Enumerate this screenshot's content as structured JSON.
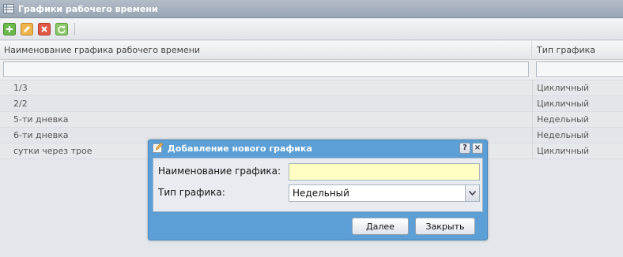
{
  "panel": {
    "title": "Графики рабочего времени"
  },
  "toolbar": {
    "buttons": [
      {
        "name": "add",
        "icon": "plus-icon",
        "color": "#5aa83a"
      },
      {
        "name": "edit",
        "icon": "pencil-icon",
        "color": "#e4a23a"
      },
      {
        "name": "delete",
        "icon": "x-icon",
        "color": "#d64a3a"
      },
      {
        "name": "refresh",
        "icon": "refresh-icon",
        "color": "#5aa83a"
      }
    ]
  },
  "grid": {
    "columns": [
      "Наименование графика рабочего времени",
      "Тип графика"
    ],
    "rows": [
      {
        "name": "1/3",
        "type": "Цикличный"
      },
      {
        "name": "2/2",
        "type": "Цикличный"
      },
      {
        "name": "5-ти дневка",
        "type": "Недельный"
      },
      {
        "name": "6-ти дневка",
        "type": "Недельный"
      },
      {
        "name": "сутки через трое",
        "type": "Цикличный"
      }
    ]
  },
  "dialog": {
    "title": "Добавление нового графика",
    "help_label": "?",
    "close_label": "×",
    "name_label": "Наименование графика:",
    "name_value": "",
    "type_label": "Тип графика:",
    "type_value": "Недельный",
    "next_button": "Далее",
    "close_button": "Закрыть",
    "header_color": "#5b9fd6",
    "input_highlight": "#ffffc4"
  }
}
